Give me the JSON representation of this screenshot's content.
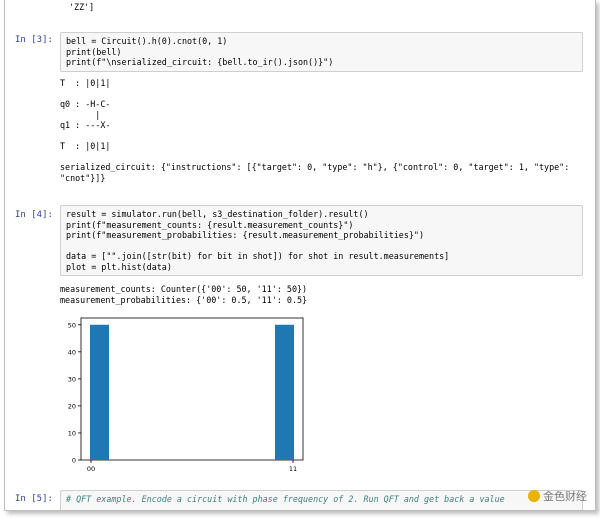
{
  "top_fragment": "'ZZ']",
  "cell3": {
    "prompt": "In [3]:",
    "lines": [
      "bell = Circuit().h(0).cnot(0, 1)",
      "print(bell)",
      "print(f\"\\nserialized_circuit: {bell.to_ir().json()}\")"
    ],
    "output": [
      "T  : |0|1|",
      "",
      "q0 : -H-C-",
      "       |",
      "q1 : ---X-",
      "",
      "T  : |0|1|",
      "",
      "serialized_circuit: {\"instructions\": [{\"target\": 0, \"type\": \"h\"}, {\"control\": 0, \"target\": 1, \"type\":",
      "\"cnot\"}]}"
    ]
  },
  "cell4": {
    "prompt": "In [4]:",
    "lines": [
      "result = simulator.run(bell, s3_destination_folder).result()",
      "print(f\"measurement_counts: {result.measurement_counts}\")",
      "print(f\"measurement_probabilities: {result.measurement_probabilities}\")",
      "",
      "data = [\"\".join([str(bit) for bit in shot]) for shot in result.measurements]",
      "plot = plt.hist(data)"
    ],
    "output": [
      "measurement_counts: Counter({'00': 50, '11': 50})",
      "measurement_probabilities: {'00': 0.5, '11': 0.5}"
    ]
  },
  "cell5": {
    "prompt": "In [5]:",
    "line": "# QFT example. Encode a circuit with phase frequency of 2. Run QFT and get back a value"
  },
  "watermark": "金色财经",
  "chart_data": {
    "type": "bar",
    "categories": [
      "00",
      "11"
    ],
    "values": [
      50,
      50
    ],
    "yticks": [
      0,
      10,
      20,
      30,
      40,
      50
    ],
    "ylim": [
      0,
      52.5
    ],
    "bar_color": "#1f77b4"
  }
}
